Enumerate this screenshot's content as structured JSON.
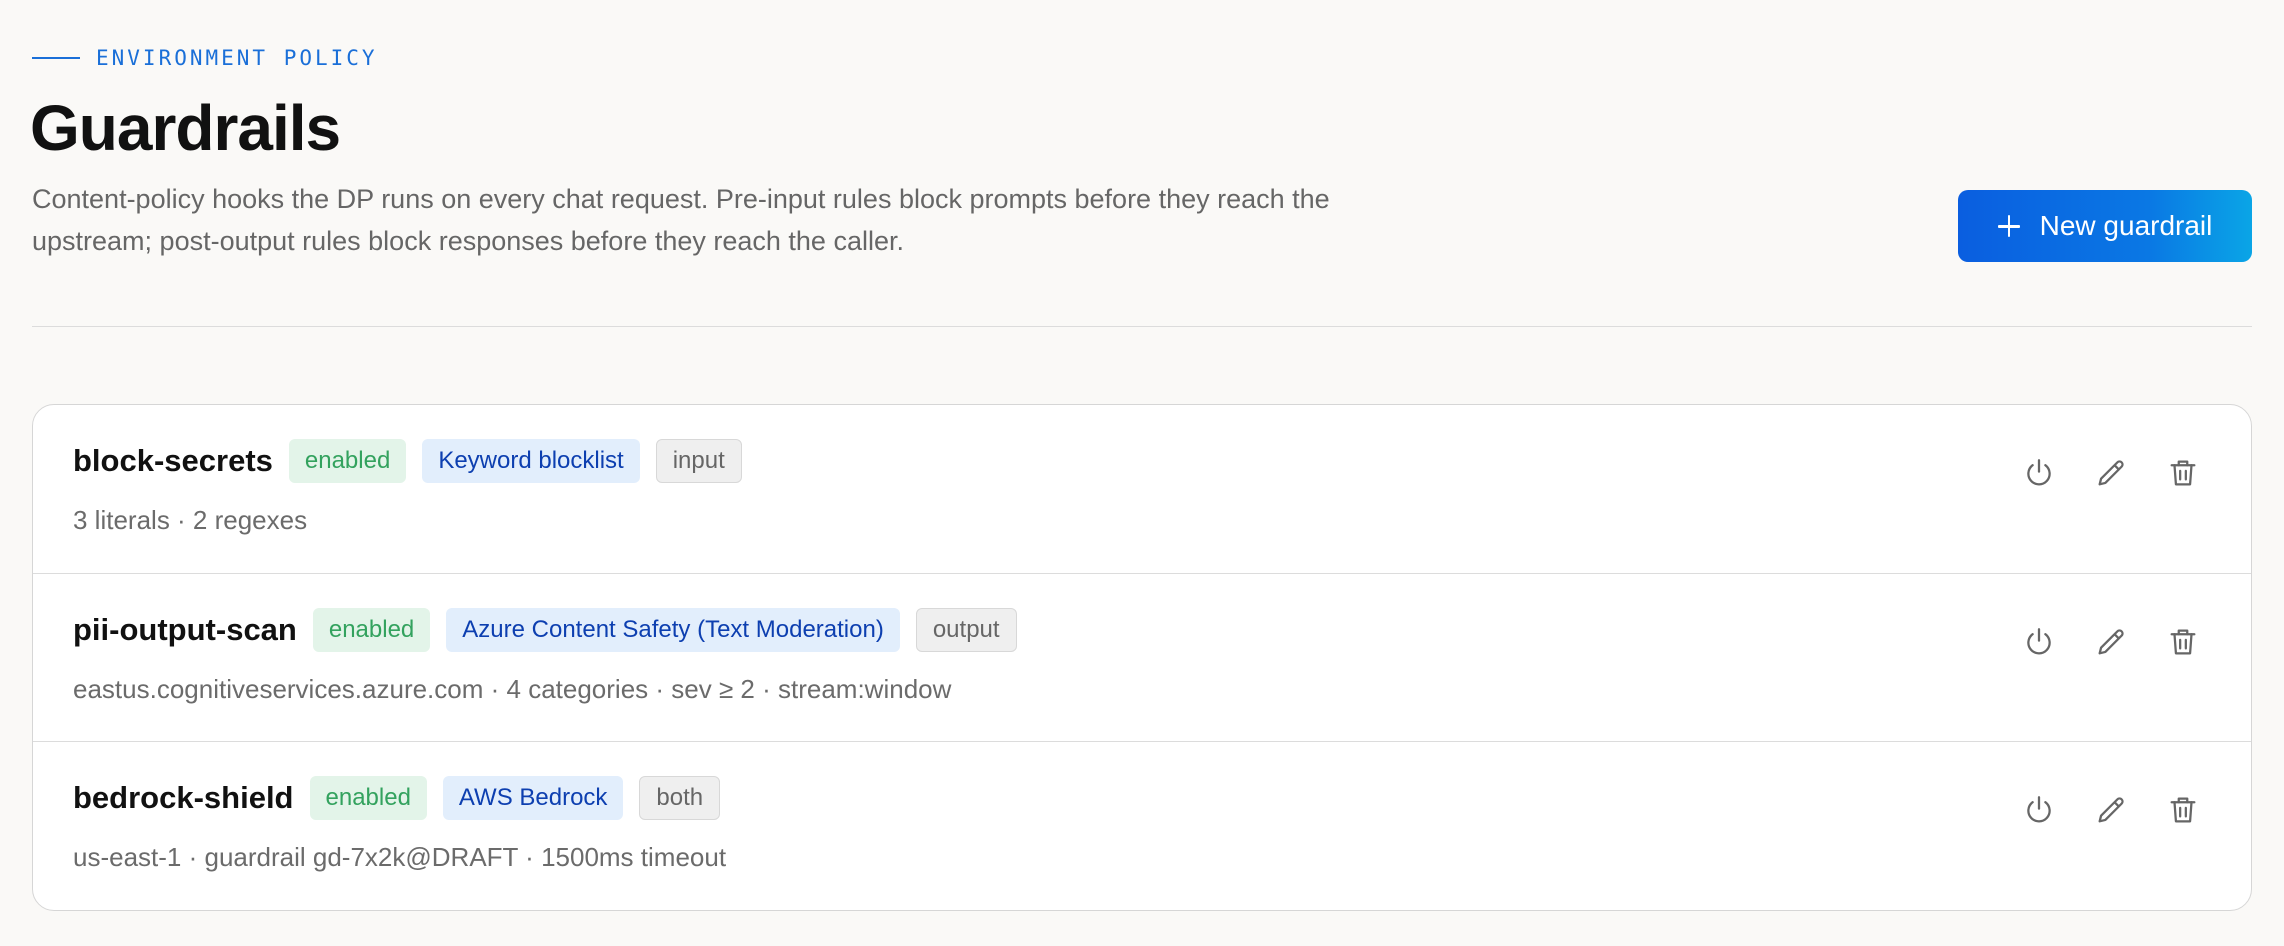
{
  "header": {
    "eyebrow": "ENVIRONMENT POLICY",
    "title": "Guardrails",
    "description": "Content-policy hooks the DP runs on every chat request. Pre-input rules block prompts before they reach the upstream; post-output rules block responses before they reach the caller.",
    "new_button_label": "New guardrail",
    "new_button_icon": "plus-icon"
  },
  "colors": {
    "accent": "#1a6fd8",
    "button_gradient_start": "#0a5ee0",
    "button_gradient_end": "#0aa5e6",
    "enabled_bg": "#e3f4e9",
    "enabled_fg": "#33a25e",
    "provider_bg": "#e2eefc",
    "provider_fg": "#0d3fb0"
  },
  "guardrails": [
    {
      "name": "block-secrets",
      "status": "enabled",
      "provider": "Keyword blocklist",
      "direction": "input",
      "meta": "3 literals · 2 regexes"
    },
    {
      "name": "pii-output-scan",
      "status": "enabled",
      "provider": "Azure Content Safety (Text Moderation)",
      "direction": "output",
      "meta": "eastus.cognitiveservices.azure.com · 4 categories · sev ≥ 2 · stream:window"
    },
    {
      "name": "bedrock-shield",
      "status": "enabled",
      "provider": "AWS Bedrock",
      "direction": "both",
      "meta": "us-east-1 · guardrail gd-7x2k@DRAFT · 1500ms timeout"
    }
  ],
  "row_actions": [
    "power-icon",
    "pencil-icon",
    "trash-icon"
  ]
}
